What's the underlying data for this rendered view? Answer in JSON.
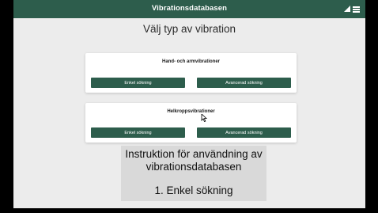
{
  "header": {
    "title": "Vibrationsdatabasen",
    "signal_icon": "signal-icon",
    "menu_icon": "hamburger-menu-icon",
    "color": "#2d5d4c"
  },
  "page": {
    "title": "Välj typ av vibration"
  },
  "cards": [
    {
      "title": "Hand- och armvibrationer",
      "buttons": [
        "Enkel sökning",
        "Avancerad sökning"
      ]
    },
    {
      "title": "Helkroppsvibrationer",
      "buttons": [
        "Enkel sökning",
        "Avancerad sökning"
      ]
    }
  ],
  "caption": {
    "line1": "Instruktion för användning av",
    "line2": "vibrationsdatabasen",
    "line3": "1. Enkel sökning"
  }
}
